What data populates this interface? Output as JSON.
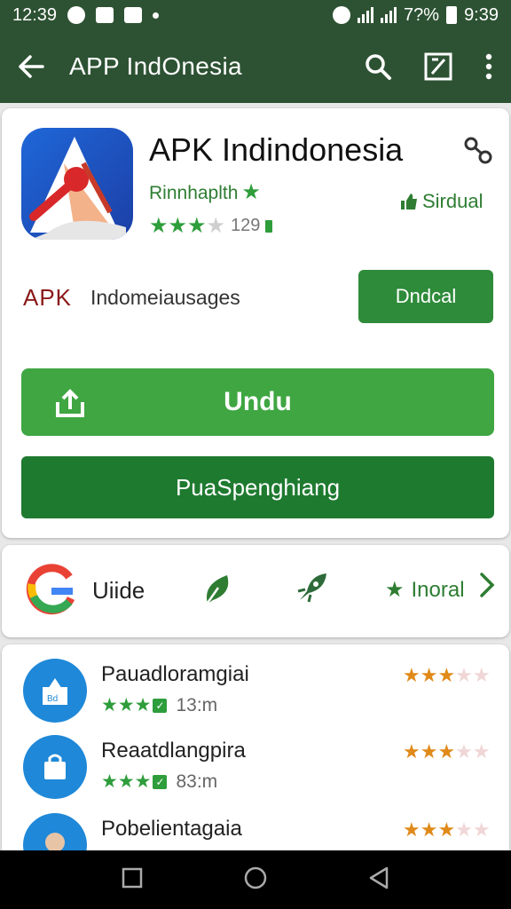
{
  "status_bar": {
    "time": "12:39",
    "battery": "7?%",
    "clock_right": "9:39"
  },
  "app_bar": {
    "title": "APP IndOnesia",
    "icons": [
      "back-arrow-icon",
      "search-icon",
      "edit-box-icon",
      "more-vert-icon"
    ]
  },
  "app_card": {
    "name": "APK Indindonesia",
    "developer": "Rinnhaplth",
    "rating_stars_filled": 3,
    "rating_count": "129",
    "install_badge": "Sirdual",
    "apk_label": "APK",
    "apk_description": "Indomeiausages",
    "download_button": "Dndcal",
    "primary_button": "Undu",
    "secondary_button": "PuaSpenghiang"
  },
  "category_bar": {
    "label": "Uiide",
    "rating_label": "Inoral"
  },
  "list": [
    {
      "title": "Pauadloramgiai",
      "count": "13:m",
      "stars": 3
    },
    {
      "title": "Reaatdlangpira",
      "count": "83:m",
      "stars": 3
    },
    {
      "title": "Pobelientagaia",
      "count": "",
      "stars": 3
    }
  ],
  "colors": {
    "app_bar": "#2d5233",
    "primary_green": "#3fa642",
    "dark_green": "#1e7a2f",
    "accent_orange": "#e08a1a"
  }
}
